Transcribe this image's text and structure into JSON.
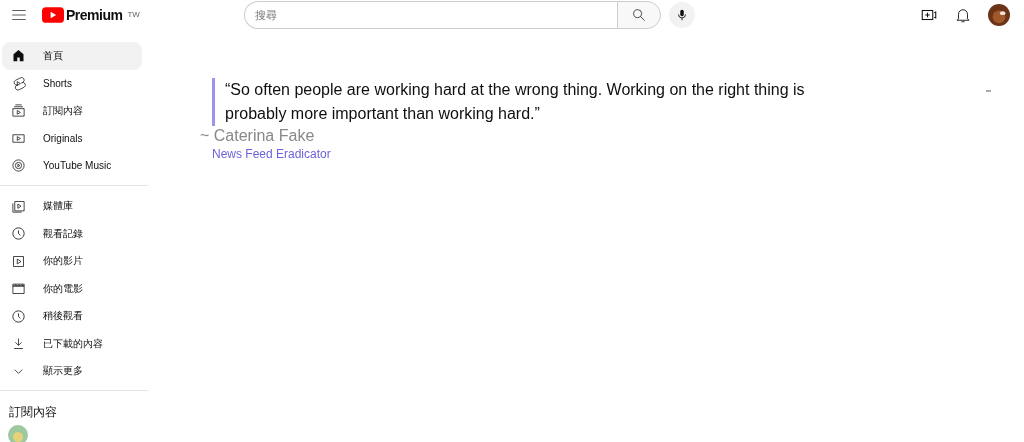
{
  "header": {
    "logo": "Premium",
    "region": "TW",
    "search": {
      "placeholder": "搜尋"
    }
  },
  "sidebar": {
    "sections": [
      {
        "items": [
          {
            "label": "首頁",
            "selected": true
          },
          {
            "label": "Shorts",
            "selected": false
          },
          {
            "label": "訂閱內容",
            "selected": false
          },
          {
            "label": "Originals",
            "selected": false
          },
          {
            "label": "YouTube Music",
            "selected": false
          }
        ]
      },
      {
        "items": [
          {
            "label": "媒體庫",
            "selected": false
          },
          {
            "label": "觀看記錄",
            "selected": false
          },
          {
            "label": "你的影片",
            "selected": false
          },
          {
            "label": "你的電影",
            "selected": false
          },
          {
            "label": "稍後觀看",
            "selected": false
          },
          {
            "label": "已下載的內容",
            "selected": false
          },
          {
            "label": "顯示更多",
            "selected": false
          }
        ]
      }
    ],
    "subscriptions_heading": "訂閱內容"
  },
  "quote": {
    "text": "“So often people are working hard at the wrong thing. Working on the right thing is probably more important than working hard.”",
    "author": "~ Caterina Fake",
    "source": "News Feed Eradicator"
  }
}
